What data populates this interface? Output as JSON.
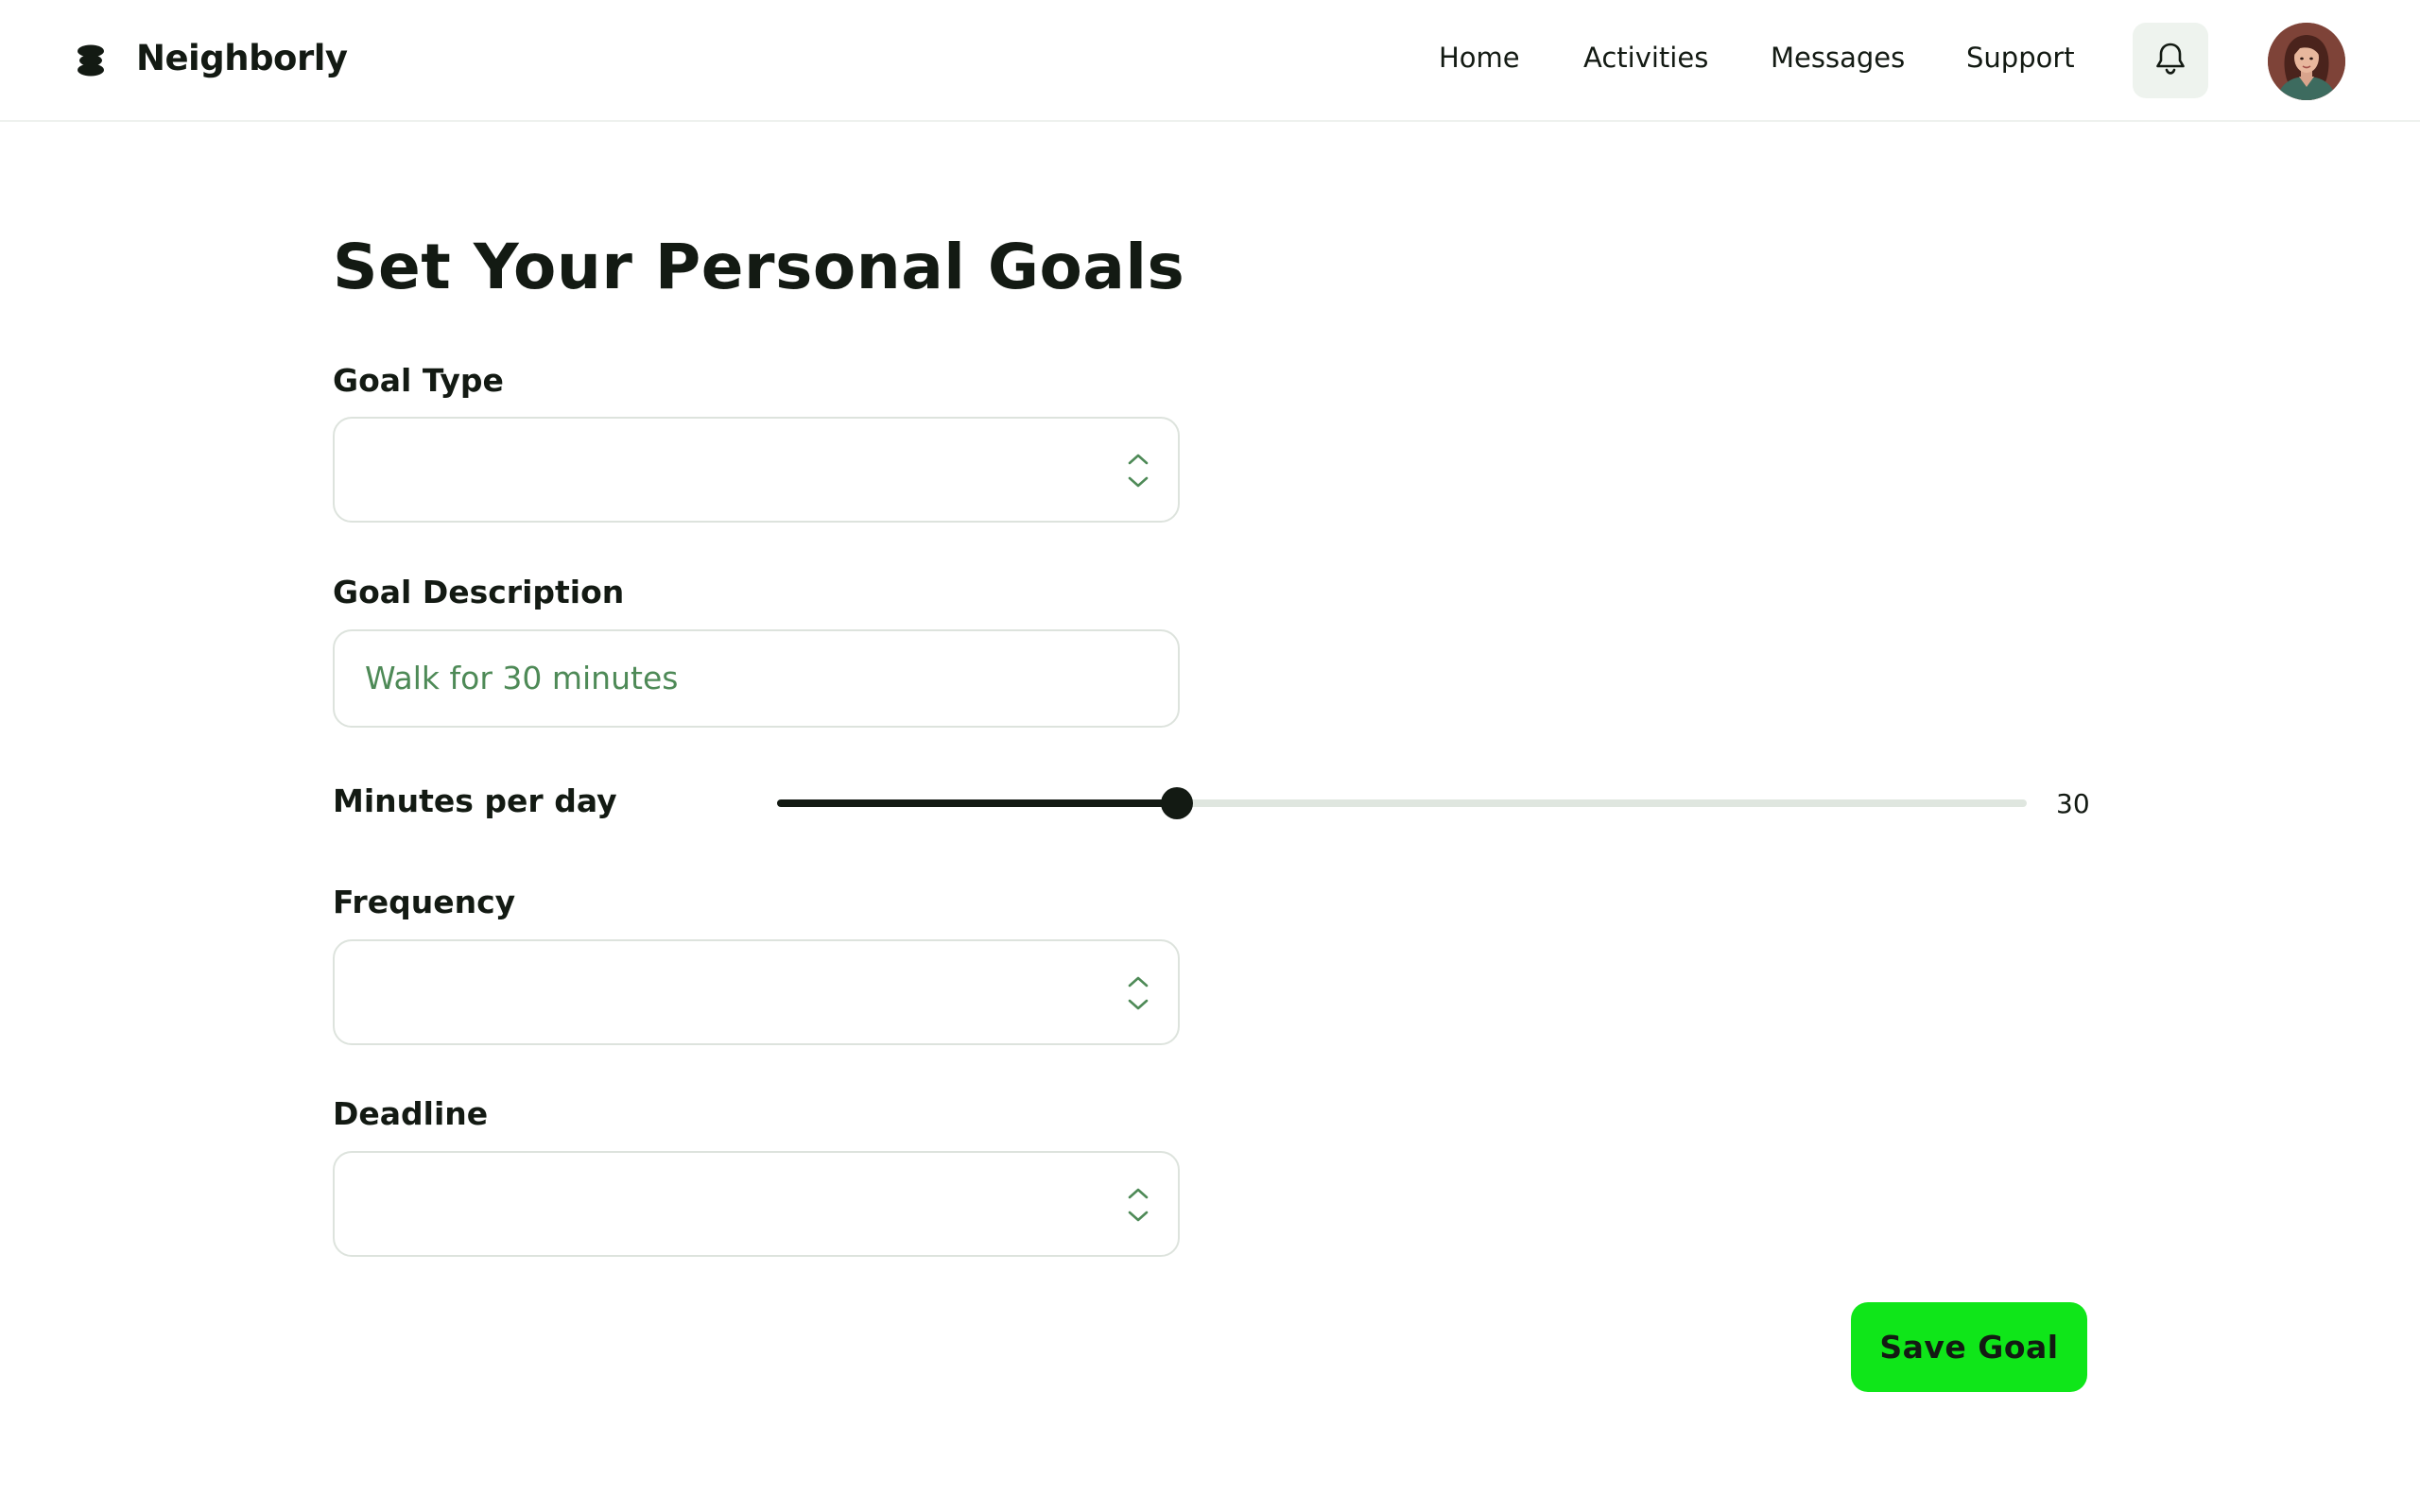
{
  "header": {
    "brand": "Neighborly",
    "nav": [
      "Home",
      "Activities",
      "Messages",
      "Support"
    ]
  },
  "icons": {
    "logo": "stacked-discs-logo-icon",
    "notifications": "bell-icon",
    "stepper": "chevron-up-down-icon"
  },
  "form": {
    "title": "Set Your Personal Goals",
    "goal_type": {
      "label": "Goal Type",
      "value": ""
    },
    "goal_description": {
      "label": "Goal Description",
      "value": "Walk for 30 minutes"
    },
    "minutes_per_day": {
      "label": "Minutes per day",
      "value": "30",
      "fraction": 0.32
    },
    "frequency": {
      "label": "Frequency",
      "value": ""
    },
    "deadline": {
      "label": "Deadline",
      "value": ""
    },
    "save_label": "Save Goal"
  },
  "colors": {
    "accent": "#0fe619",
    "text": "#131a13",
    "input_text": "#4e8a57",
    "border": "#dde3dd",
    "bell_bg": "#eef3ee",
    "slider_track": "#dfe6df"
  }
}
